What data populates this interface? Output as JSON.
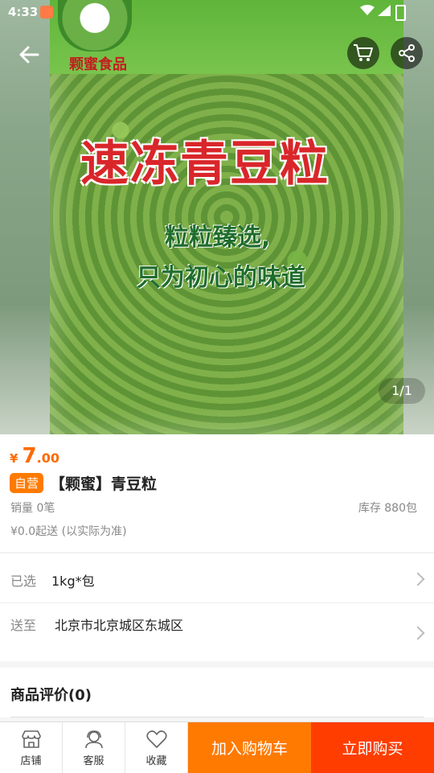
{
  "status_bar": {
    "time": "4:33"
  },
  "product_image": {
    "brand_text": "颗蜜食品",
    "title": "速冻青豆粒",
    "line1": "粒粒臻选,",
    "line2": "只为初心的味道",
    "page_indicator": "1/1"
  },
  "product": {
    "price_currency": "¥",
    "price_integer": "7",
    "price_decimal": ".00",
    "tag": "自营",
    "title": "【颗蜜】青豆粒",
    "sales": "销量 0笔",
    "stock": "库存 880包",
    "min_order": "¥0.0起送 (以实际为准)"
  },
  "selection": {
    "label": "已选",
    "value": "1kg*包"
  },
  "shipping": {
    "label": "送至",
    "value": "北京市北京城区东城区"
  },
  "reviews": {
    "header": "商品评价(0)"
  },
  "bottom_bar": {
    "store": "店铺",
    "service": "客服",
    "favorite": "收藏",
    "add_to_cart": "加入购物车",
    "buy_now": "立即购买"
  },
  "colors": {
    "accent": "#ff7a00",
    "buy": "#ff3d00",
    "price": "#ff6a00"
  }
}
